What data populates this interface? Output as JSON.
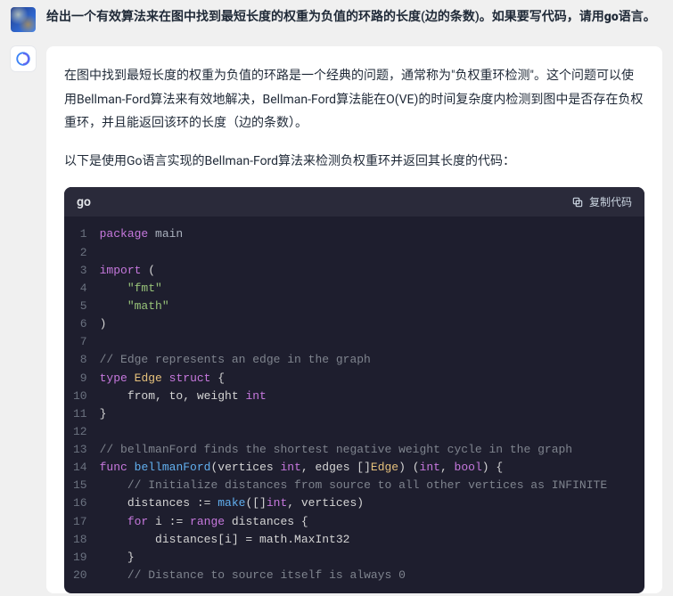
{
  "user": {
    "message_prefix": "给出一个有效算法来在图中找到最短长度的权重为负值的环路的长度(边的条数)。如果要写代码，请用",
    "message_bold": "go",
    "message_suffix": "语言。"
  },
  "assistant": {
    "para1": "在图中找到最短长度的权重为负值的环路是一个经典的问题，通常称为\"负权重环检测\"。这个问题可以使用Bellman-Ford算法来有效地解决，Bellman-Ford算法能在O(VE)的时间复杂度内检测到图中是否存在负权重环，并且能返回该环的长度（边的条数）。",
    "para2": "以下是使用Go语言实现的Bellman-Ford算法来检测负权重环并返回其长度的代码："
  },
  "code": {
    "language": "go",
    "copy_label": "复制代码",
    "lines": [
      {
        "n": 1,
        "seg": [
          [
            "kw",
            "package"
          ],
          [
            "",
            ""
          ],
          [
            "ident",
            " main"
          ]
        ]
      },
      {
        "n": 2,
        "seg": []
      },
      {
        "n": 3,
        "seg": [
          [
            "kw",
            "import"
          ],
          [
            "",
            " ("
          ]
        ]
      },
      {
        "n": 4,
        "seg": [
          [
            "",
            "    "
          ],
          [
            "str",
            "\"fmt\""
          ]
        ]
      },
      {
        "n": 5,
        "seg": [
          [
            "",
            "    "
          ],
          [
            "str",
            "\"math\""
          ]
        ]
      },
      {
        "n": 6,
        "seg": [
          [
            "",
            ")"
          ]
        ]
      },
      {
        "n": 7,
        "seg": []
      },
      {
        "n": 8,
        "seg": [
          [
            "cmt",
            "// Edge represents an edge in the graph"
          ]
        ]
      },
      {
        "n": 9,
        "seg": [
          [
            "kw",
            "type"
          ],
          [
            "",
            " "
          ],
          [
            "name",
            "Edge"
          ],
          [
            "",
            " "
          ],
          [
            "kw",
            "struct"
          ],
          [
            "",
            " {"
          ]
        ]
      },
      {
        "n": 10,
        "seg": [
          [
            "",
            "    from, to, weight "
          ],
          [
            "int",
            "int"
          ]
        ]
      },
      {
        "n": 11,
        "seg": [
          [
            "",
            "}"
          ]
        ]
      },
      {
        "n": 12,
        "seg": []
      },
      {
        "n": 13,
        "seg": [
          [
            "cmt",
            "// bellmanFord finds the shortest negative weight cycle in the graph"
          ]
        ]
      },
      {
        "n": 14,
        "seg": [
          [
            "kw",
            "func"
          ],
          [
            "",
            " "
          ],
          [
            "func",
            "bellmanFord"
          ],
          [
            "",
            "(vertices "
          ],
          [
            "int",
            "int"
          ],
          [
            "",
            ", edges []"
          ],
          [
            "name",
            "Edge"
          ],
          [
            "",
            ") ("
          ],
          [
            "int",
            "int"
          ],
          [
            "",
            ", "
          ],
          [
            "int",
            "bool"
          ],
          [
            "",
            ") {"
          ]
        ]
      },
      {
        "n": 15,
        "seg": [
          [
            "",
            "    "
          ],
          [
            "cmt",
            "// Initialize distances from source to all other vertices as INFINITE"
          ]
        ]
      },
      {
        "n": 16,
        "seg": [
          [
            "",
            "    distances := "
          ],
          [
            "func",
            "make"
          ],
          [
            "",
            "([]"
          ],
          [
            "int",
            "int"
          ],
          [
            "",
            ", vertices)"
          ]
        ]
      },
      {
        "n": 17,
        "seg": [
          [
            "",
            "    "
          ],
          [
            "kw",
            "for"
          ],
          [
            "",
            " i := "
          ],
          [
            "kw",
            "range"
          ],
          [
            "",
            " distances {"
          ]
        ]
      },
      {
        "n": 18,
        "seg": [
          [
            "",
            "        distances[i] = math.MaxInt32"
          ]
        ]
      },
      {
        "n": 19,
        "seg": [
          [
            "",
            "    }"
          ]
        ]
      },
      {
        "n": 20,
        "seg": [
          [
            "",
            "    "
          ],
          [
            "cmt",
            "// Distance to source itself is always 0"
          ]
        ]
      }
    ]
  }
}
